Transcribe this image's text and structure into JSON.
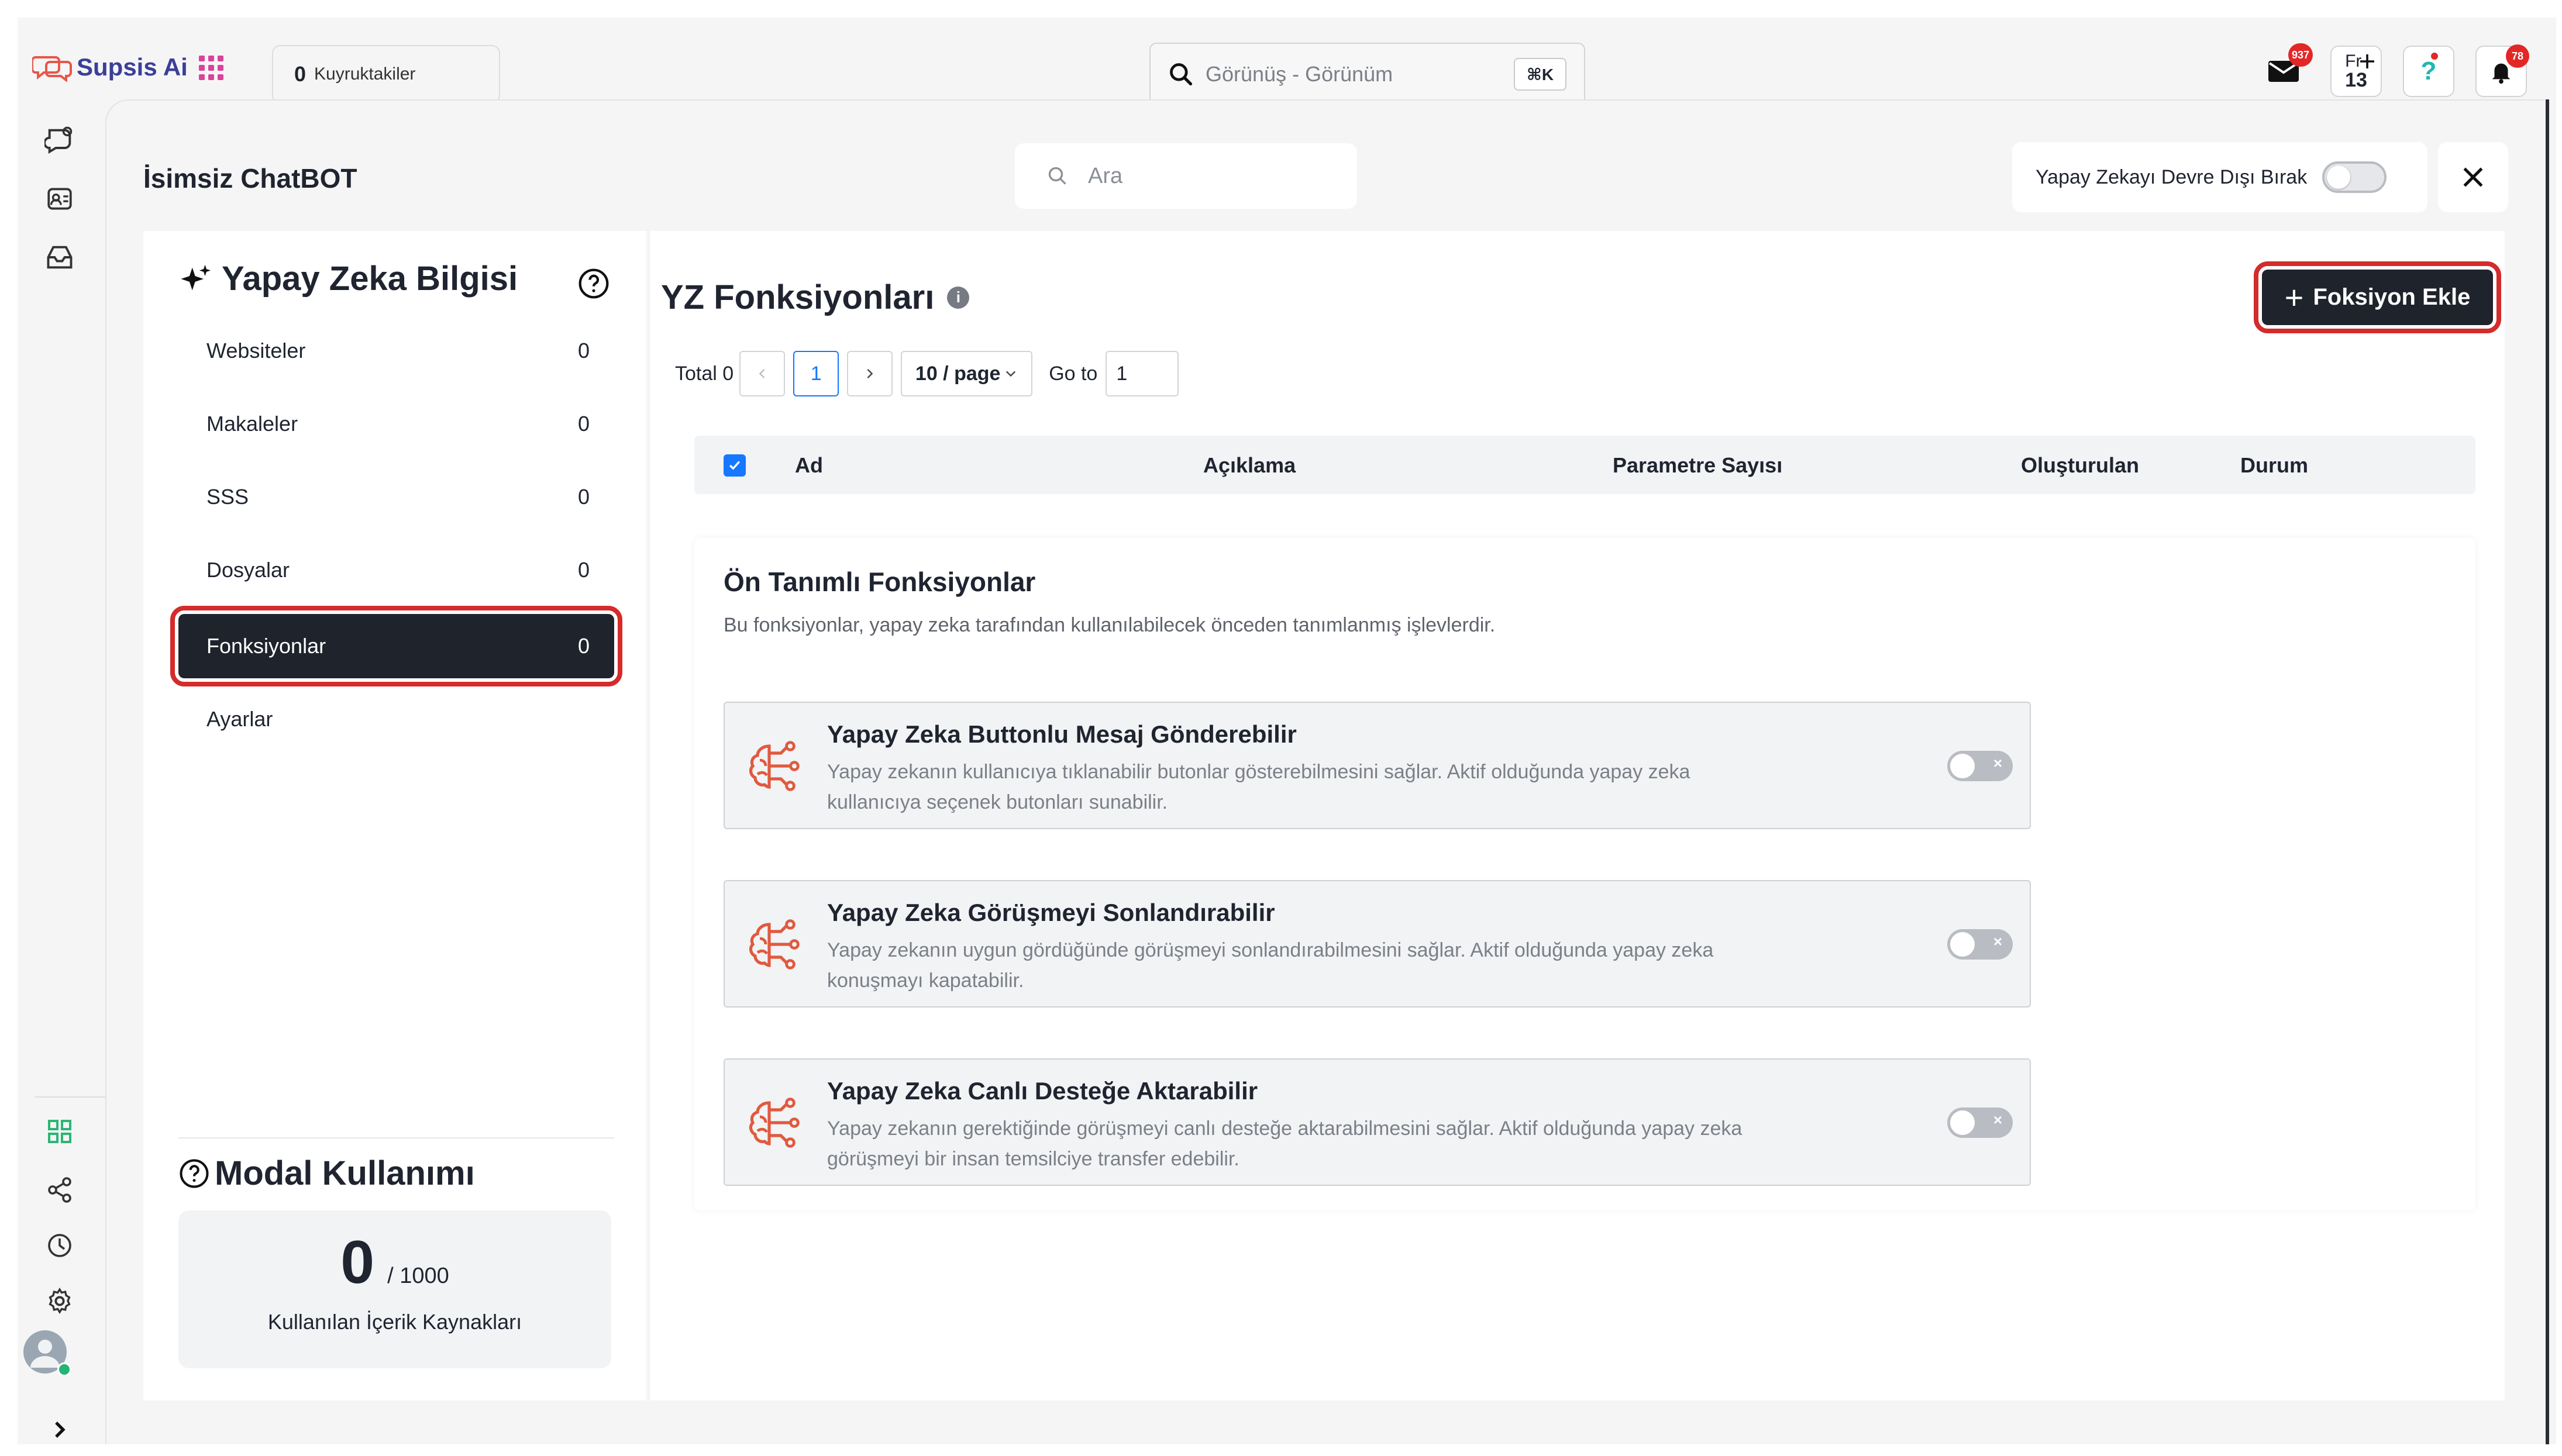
{
  "app": {
    "name": "Supsis Ai"
  },
  "header": {
    "queue": {
      "count": "0",
      "label": "Kuyruktakiler"
    },
    "search": {
      "placeholder": "Görünüş - Görünüm",
      "shortcut": "⌘K"
    },
    "mail_badge": "937",
    "calendar": {
      "day_label": "Fr",
      "day_number": "13"
    },
    "help_label": "?",
    "notify_badge": "78"
  },
  "panel": {
    "bot_title": "İsimsiz ChatBOT",
    "search_placeholder": "Ara",
    "ai_disable_label": "Yapay Zekayı Devre Dışı Bırak",
    "ai_disabled": false
  },
  "knowledge": {
    "title": "Yapay Zeka Bilgisi",
    "items": [
      {
        "label": "Websiteler",
        "count": "0"
      },
      {
        "label": "Makaleler",
        "count": "0"
      },
      {
        "label": "SSS",
        "count": "0"
      },
      {
        "label": "Dosyalar",
        "count": "0"
      },
      {
        "label": "Fonksiyonlar",
        "count": "0"
      },
      {
        "label": "Ayarlar",
        "count": ""
      }
    ],
    "active_index": 4
  },
  "usage": {
    "title": "Modal Kullanımı",
    "used": "0",
    "total": "/ 1000",
    "label": "Kullanılan İçerik Kaynakları"
  },
  "functions": {
    "title": "YZ Fonksiyonları",
    "add_button": "Foksiyon Ekle",
    "pager": {
      "total": "Total 0",
      "current_page": "1",
      "page_size": "10 / page",
      "goto_label": "Go to",
      "goto_value": "1"
    },
    "columns": [
      "Ad",
      "Açıklama",
      "Parametre Sayısı",
      "Oluşturulan",
      "Durum"
    ],
    "predefined": {
      "title": "Ön Tanımlı Fonksiyonlar",
      "description": "Bu fonksiyonlar, yapay zeka tarafından kullanılabilecek önceden tanımlanmış işlevlerdir.",
      "items": [
        {
          "title": "Yapay Zeka Buttonlu Mesaj Gönderebilir",
          "line1": "Yapay zekanın kullanıcıya tıklanabilir butonlar gösterebilmesini sağlar. Aktif olduğunda yapay zeka",
          "line2": "kullanıcıya seçenek butonları sunabilir.",
          "enabled": false
        },
        {
          "title": "Yapay Zeka Görüşmeyi Sonlandırabilir",
          "line1": "Yapay zekanın uygun gördüğünde görüşmeyi sonlandırabilmesini sağlar. Aktif olduğunda yapay zeka",
          "line2": "konuşmayı kapatabilir.",
          "enabled": false
        },
        {
          "title": "Yapay Zeka Canlı Desteğe Aktarabilir",
          "line1": "Yapay zekanın gerektiğinde görüşmeyi canlı desteğe aktarabilmesini sağlar. Aktif olduğunda yapay zeka",
          "line2": "görüşmeyi bir insan temsilciye transfer edebilir.",
          "enabled": false
        }
      ]
    }
  },
  "colors": {
    "accent": "#1677ff",
    "dark": "#1f232b",
    "highlight": "#d42b2b",
    "brand": "#3b3f98",
    "icon": "#e05a3f"
  }
}
